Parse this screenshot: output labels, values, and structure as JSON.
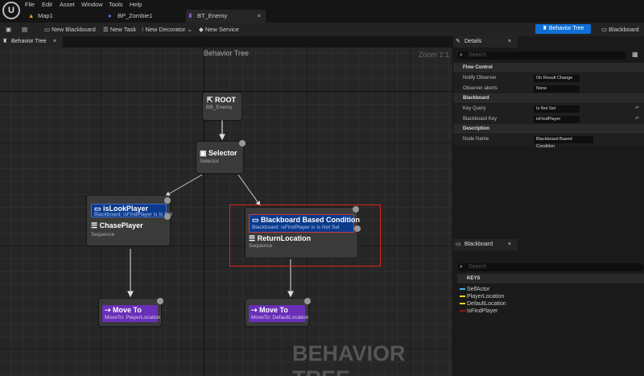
{
  "menu": [
    "File",
    "Edit",
    "Asset",
    "Window",
    "Tools",
    "Help"
  ],
  "doc_tabs": [
    {
      "label": "Map1"
    },
    {
      "label": "BP_Zombie1"
    },
    {
      "label": "BT_Enemy",
      "active": true
    }
  ],
  "toolbar": {
    "new_blackboard": "New Blackboard",
    "new_task": "New Task",
    "new_decorator": "New Decorator",
    "new_service": "New Service",
    "behavior_tree": "Behavior Tree",
    "blackboard": "Blackboard"
  },
  "panel_tab": "Behavior Tree",
  "graph": {
    "title": "Behavior Tree",
    "zoom": "Zoom 1:1",
    "watermark": "BEHAVIOR TREE"
  },
  "nodes": {
    "root": {
      "title": "ROOT",
      "sub": "BB_Enemy"
    },
    "selector": {
      "title": "Selector",
      "sub": "Selector"
    },
    "left_dec": {
      "title": "isLookPlayer",
      "sub": "Blackboard: isFindPlayer is Is Set"
    },
    "left_seq": {
      "title": "ChasePlayer",
      "sub": "Sequence"
    },
    "right_dec": {
      "title": "Blackboard Based Condition",
      "sub": "Blackboard: isFindPlayer is Is Not Set"
    },
    "right_seq": {
      "title": "ReturnLocation",
      "sub": "Sequence"
    },
    "move1": {
      "title": "Move To",
      "sub": "MoveTo: PlayerLocation"
    },
    "move2": {
      "title": "Move To",
      "sub": "MoveTo: DefaultLocation"
    }
  },
  "details": {
    "tab": "Details",
    "search_placeholder": "Search",
    "flow_control": "Flow Control",
    "notify_observer_label": "Notify Observer",
    "notify_observer": "On Result Change",
    "observer_aborts_label": "Observer aborts",
    "observer_aborts": "None",
    "blackboard": "Blackboard",
    "key_query_label": "Key Query",
    "key_query": "Is Not Set",
    "blackboard_key_label": "Blackboard Key",
    "blackboard_key": "isFindPlayer",
    "description": "Description",
    "node_name_label": "Node Name",
    "node_name": "Blackboard Based Condition"
  },
  "blackboard_panel": {
    "tab": "Blackboard",
    "search_placeholder": "Search",
    "keys_header": "KEYS",
    "keys": [
      {
        "name": "SelfActor",
        "color": "#3cb4f0"
      },
      {
        "name": "PlayerLocation",
        "color": "#f0d020"
      },
      {
        "name": "DefaultLocation",
        "color": "#f0d020"
      },
      {
        "name": "isFindPlayer",
        "color": "#a01010"
      }
    ]
  }
}
